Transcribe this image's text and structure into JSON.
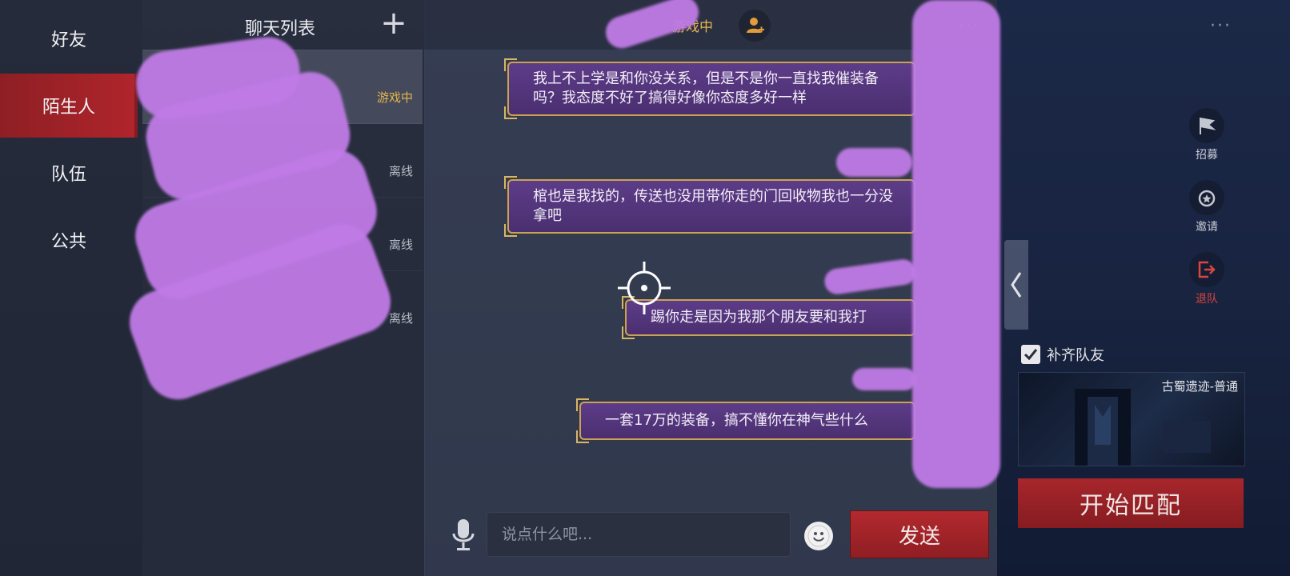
{
  "nav": {
    "items": [
      {
        "label": "好友"
      },
      {
        "label": "陌生人"
      },
      {
        "label": "队伍"
      },
      {
        "label": "公共"
      }
    ]
  },
  "chat_list": {
    "title": "聊天列表",
    "add_label": "+",
    "rows": [
      {
        "status": "游戏中"
      },
      {
        "status": "离线"
      },
      {
        "status": "离线"
      },
      {
        "status": "离线"
      }
    ]
  },
  "chat_header": {
    "status": "游戏中",
    "more": "···"
  },
  "messages": [
    {
      "text": "我上不上学是和你没关系，但是不是你一直找我催装备吗？我态度不好了搞得好像你态度多好一样"
    },
    {
      "text": "棺也是我找的，传送也没用带你走的门回收物我也一分没拿吧"
    },
    {
      "text": "踢你走是因为我那个朋友要和我打"
    },
    {
      "text": "一套17万的装备，搞不懂你在神气些什么"
    }
  ],
  "input": {
    "placeholder": "说点什么吧...",
    "value": ""
  },
  "send_label": "发送",
  "right_panel": {
    "more": "···",
    "buttons": [
      {
        "label": "招募",
        "icon": "flag-icon"
      },
      {
        "label": "邀请",
        "icon": "medal-icon"
      },
      {
        "label": "退队",
        "icon": "exit-icon"
      }
    ],
    "fill_team_label": "补齐队友",
    "fill_team_checked": true,
    "map_label": "古蜀遗迹-普通",
    "start_label": "开始匹配"
  },
  "colors": {
    "accent_red": "#a7262c",
    "bubble_purple": "#5d3c88",
    "gold": "#c7a35a",
    "status_ingame": "#e6b44d"
  }
}
